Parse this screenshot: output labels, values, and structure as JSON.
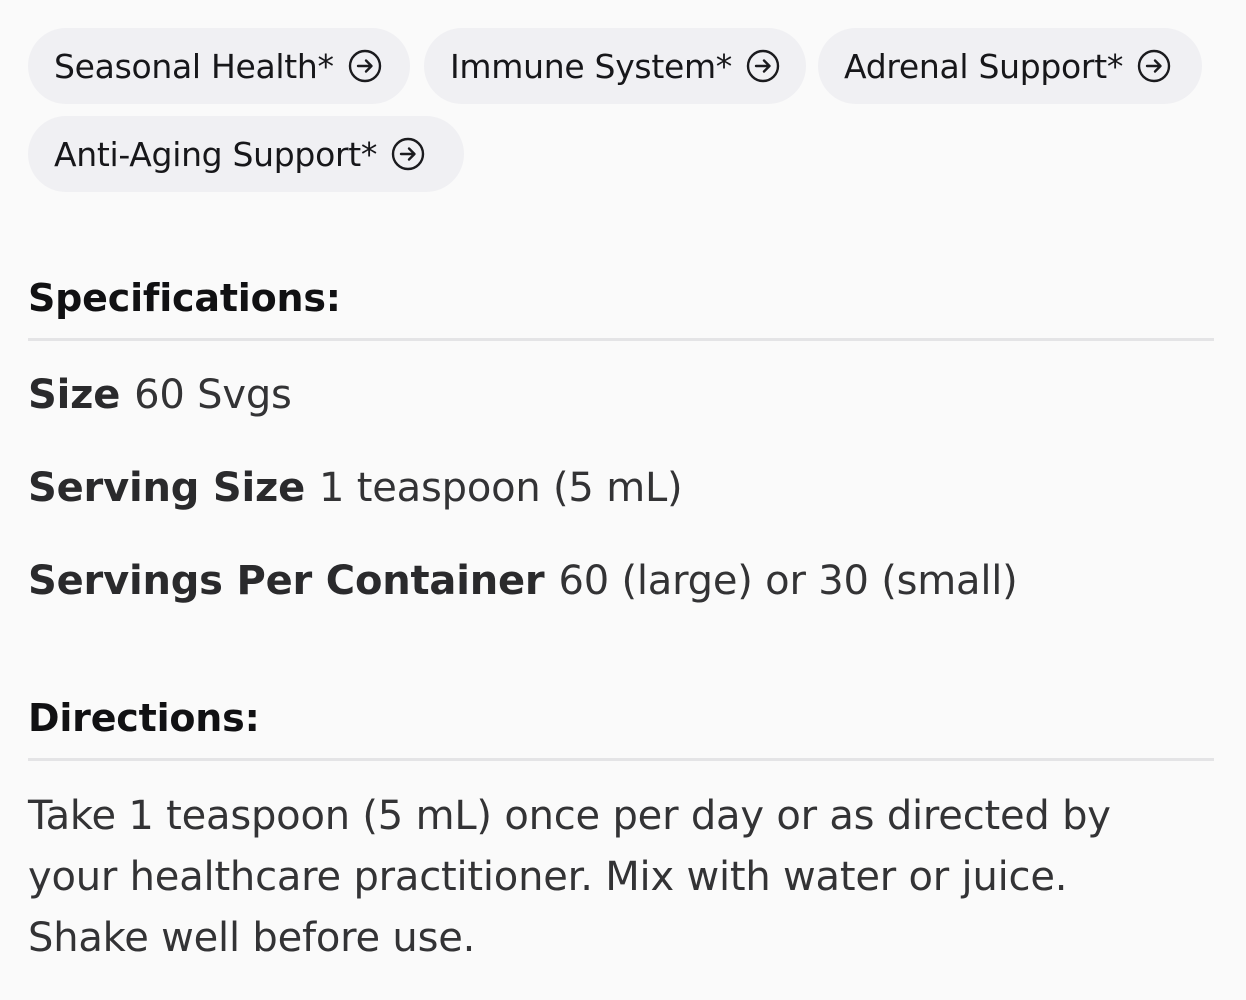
{
  "tags": [
    {
      "label": "Seasonal Health*",
      "icon": "arrow-circle-right-icon"
    },
    {
      "label": "Immune System*",
      "icon": "arrow-circle-right-icon"
    },
    {
      "label": "Adrenal Support*",
      "icon": "arrow-circle-right-icon"
    },
    {
      "label": "Anti-Aging Support*",
      "icon": "arrow-circle-right-icon"
    }
  ],
  "specifications": {
    "title": "Specifications:",
    "rows": [
      {
        "key": "Size",
        "value": "60 Svgs"
      },
      {
        "key": "Serving Size",
        "value": "1 teaspoon (5 mL)"
      },
      {
        "key": "Servings Per Container",
        "value": "60 (large) or 30 (small)"
      }
    ]
  },
  "directions": {
    "title": "Directions:",
    "text": "Take 1 teaspoon (5 mL) once per day or as directed by your healthcare practitioner. Mix with water or juice. Shake well before use."
  },
  "colors": {
    "page_background": "#fafafa",
    "tag_background": "#f0f0f3",
    "divider": "#e4e4e6",
    "text": "#1e1e20"
  }
}
